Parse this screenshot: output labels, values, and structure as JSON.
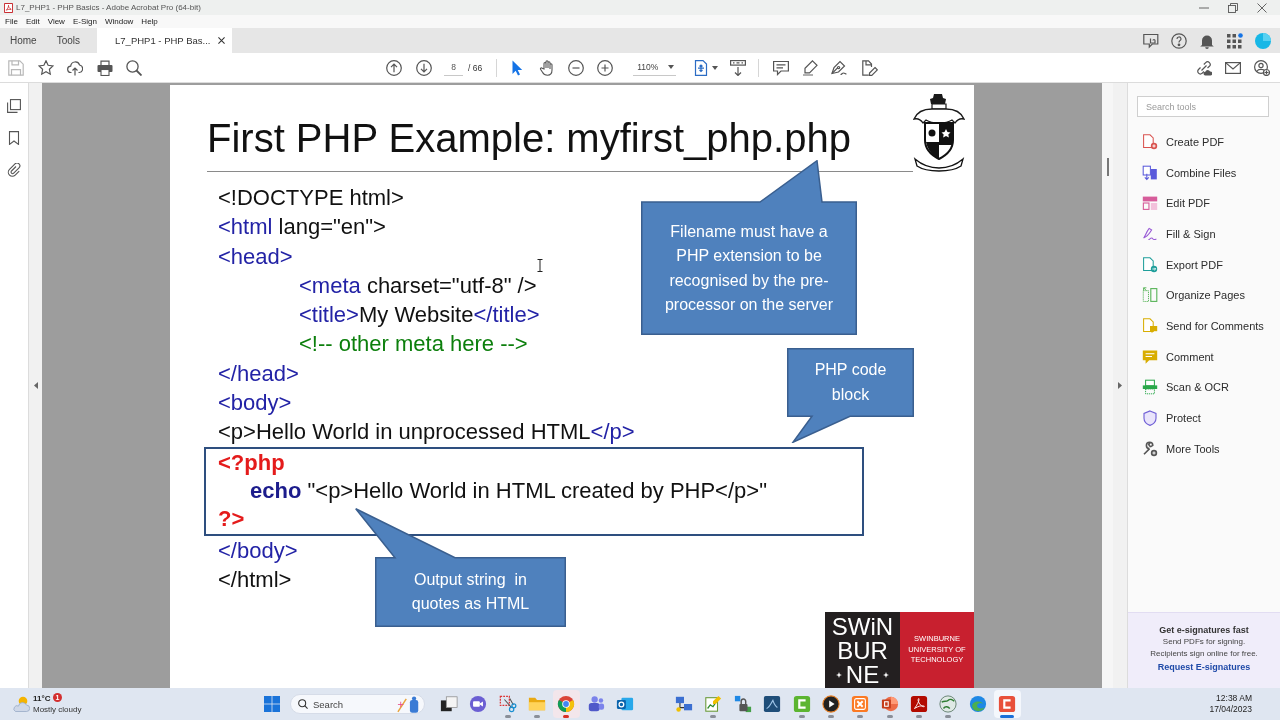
{
  "window": {
    "title": "L7_PHP1 - PHP Basics - Adobe Acrobat Pro (64-bit)"
  },
  "menu": [
    "File",
    "Edit",
    "View",
    "E-Sign",
    "Window",
    "Help"
  ],
  "tabs": [
    {
      "label": "Home",
      "selected": false,
      "closable": false
    },
    {
      "label": "Tools",
      "selected": false,
      "closable": false
    },
    {
      "label": "L7_PHP1 - PHP Bas...",
      "selected": true,
      "closable": true
    }
  ],
  "toolbar": {
    "save": {
      "disabled": true
    },
    "page_number": "8",
    "page_count": "/ 66",
    "tools": [
      {
        "kind": "select",
        "selected": true
      },
      {
        "kind": "hand",
        "selected": false
      }
    ],
    "zoom": "110%"
  },
  "slide": {
    "title": "First PHP Example: myfirst_php.php",
    "code": [
      {
        "kind": "plain",
        "lines": [
          {
            "segments": [
              {
                "kind": "text",
                "text": "<!DOCTYPE html>"
              }
            ]
          },
          {
            "segments": [
              {
                "kind": "tag",
                "text": "<html"
              },
              {
                "kind": "text",
                "text": " lang=\"en\">"
              }
            ]
          },
          {
            "segments": [
              {
                "kind": "tag",
                "text": "<head>"
              }
            ],
            "children": [
              {
                "segments": [
                  {
                    "kind": "tag",
                    "text": "<meta"
                  },
                  {
                    "kind": "text",
                    "text": " charset=\"utf-8\" />"
                  }
                ]
              },
              {
                "segments": [
                  {
                    "kind": "tag",
                    "text": "<title>"
                  },
                  {
                    "kind": "text",
                    "text": "My Website"
                  },
                  {
                    "kind": "tag",
                    "text": "</title>"
                  }
                ]
              },
              {
                "segments": [
                  {
                    "kind": "comment",
                    "text": "<!-- other meta here -->"
                  }
                ]
              }
            ]
          },
          {
            "segments": [
              {
                "kind": "tag",
                "text": "</head>"
              }
            ]
          },
          {
            "segments": [
              {
                "kind": "tag",
                "text": "<body>"
              }
            ]
          },
          {
            "segments": [
              {
                "kind": "text",
                "text": "<p>Hello World in unprocessed HTML"
              },
              {
                "kind": "tag",
                "text": "</p>"
              }
            ]
          }
        ]
      },
      {
        "kind": "php",
        "lines": [
          {
            "segments": [
              {
                "kind": "php",
                "text": "<?php"
              }
            ],
            "children": [
              {
                "segments": [
                  {
                    "kind": "keyword",
                    "text": "echo"
                  },
                  {
                    "kind": "text",
                    "text": " \"<p>Hello World in HTML created by PHP</p>\""
                  }
                ]
              }
            ]
          },
          {
            "segments": [
              {
                "kind": "php",
                "text": "?>"
              }
            ]
          }
        ]
      },
      {
        "kind": "plain",
        "lines": [
          {
            "segments": [
              {
                "kind": "tag",
                "text": "</body>"
              }
            ]
          },
          {
            "segments": [
              {
                "kind": "text",
                "text": "</html>"
              }
            ]
          }
        ]
      }
    ],
    "callouts": [
      {
        "text": "Filename must have a PHP extension to be recognised by the pre-processor on the server"
      },
      {
        "text": "PHP code block"
      },
      {
        "text": "Output string  in quotes as HTML"
      }
    ],
    "logo": {
      "wordmark": [
        "SWiN",
        "BUR",
        "NE"
      ],
      "caption": "SWINBURNE UNIVERSITY OF TECHNOLOGY"
    }
  },
  "tools_panel": {
    "search": {
      "placeholder": "Search tools"
    },
    "items": [
      {
        "label": "Create PDF",
        "kind": "create"
      },
      {
        "label": "Combine Files",
        "kind": "combine"
      },
      {
        "label": "Edit PDF",
        "kind": "edit"
      },
      {
        "label": "Fill & Sign",
        "kind": "fill-sign"
      },
      {
        "label": "Export PDF",
        "kind": "export"
      },
      {
        "label": "Organize Pages",
        "kind": "organize"
      },
      {
        "label": "Send for Comments",
        "kind": "send"
      },
      {
        "label": "Comment",
        "kind": "comment"
      },
      {
        "label": "Scan & OCR",
        "kind": "scan"
      },
      {
        "label": "Protect",
        "kind": "protect"
      },
      {
        "label": "More Tools",
        "kind": "more"
      }
    ],
    "promo": {
      "title": "Get e-signatures fast",
      "lines": [
        "Send PDFs for signing.",
        "Recipients sign online for free."
      ],
      "link": "Request E-signatures"
    }
  },
  "taskbar": {
    "weather": {
      "temperature": "11°C",
      "condition": "Mostly cloudy",
      "badge": "1"
    },
    "search": {
      "placeholder": "Search"
    },
    "apps": [
      {
        "kind": "task-view",
        "running": false,
        "selected": false,
        "attention": false
      },
      {
        "kind": "video-chat",
        "running": false,
        "selected": false,
        "attention": false
      },
      {
        "kind": "snipping",
        "running": true,
        "selected": false,
        "attention": false
      },
      {
        "kind": "folder",
        "running": true,
        "selected": false,
        "attention": false
      },
      {
        "kind": "browser",
        "running": true,
        "selected": false,
        "attention": true
      },
      {
        "kind": "team",
        "running": false,
        "selected": false,
        "attention": false
      },
      {
        "kind": "mail",
        "running": false,
        "selected": false,
        "attention": false
      },
      {
        "kind": "network",
        "running": false,
        "selected": false,
        "attention": false
      },
      {
        "kind": "chart",
        "running": true,
        "selected": false,
        "attention": false
      },
      {
        "kind": "lock",
        "running": false,
        "selected": false,
        "attention": false
      },
      {
        "kind": "wave-tile",
        "running": false,
        "selected": false,
        "attention": false
      },
      {
        "kind": "recorder",
        "running": true,
        "selected": false,
        "attention": false
      },
      {
        "kind": "player",
        "running": true,
        "selected": false,
        "attention": false
      },
      {
        "kind": "cross-tile",
        "running": true,
        "selected": false,
        "attention": false
      },
      {
        "kind": "slides",
        "running": true,
        "selected": false,
        "attention": false
      },
      {
        "kind": "pdf",
        "running": true,
        "selected": false,
        "attention": false
      },
      {
        "kind": "globe",
        "running": true,
        "selected": false,
        "attention": false
      },
      {
        "kind": "swirl",
        "running": false,
        "selected": false,
        "attention": false
      },
      {
        "kind": "editor",
        "running": true,
        "selected": true,
        "attention": false
      }
    ],
    "clock": {
      "time": "12:38 AM",
      "date": "17/04/2023"
    }
  }
}
